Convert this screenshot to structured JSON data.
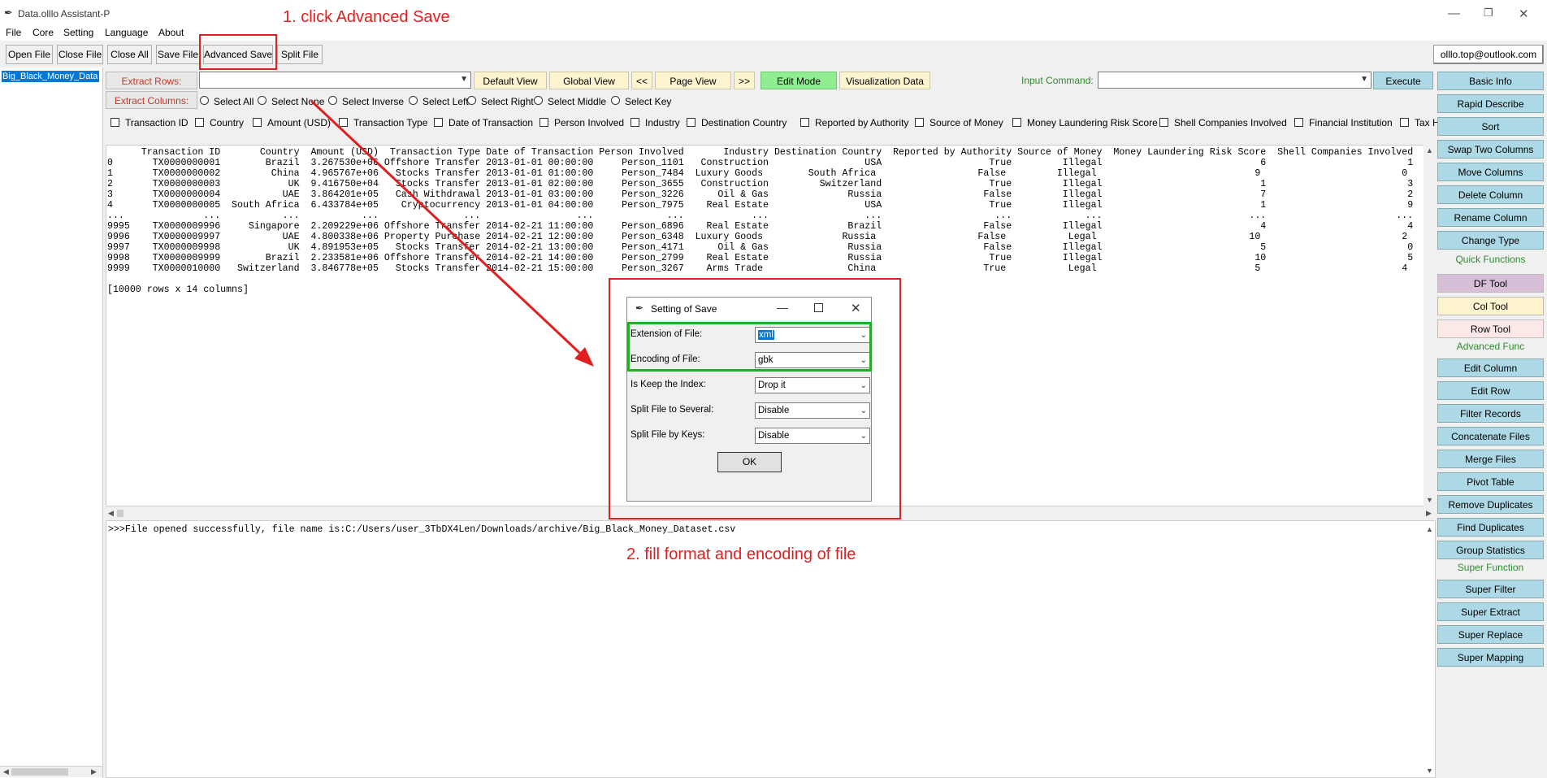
{
  "window": {
    "title": "Data.olllo Assistant-P",
    "controls": {
      "minimize": "—",
      "restore": "❐",
      "close": "✕"
    }
  },
  "menu": [
    "File",
    "Core",
    "Setting",
    "Language",
    "About"
  ],
  "toolbar": {
    "buttons": [
      "Open File",
      "Close File",
      "Close All",
      "Save File",
      "Advanced Save",
      "Split File"
    ],
    "account": "olllo.top@outlook.com"
  },
  "file_list": {
    "selected": "Big_Black_Money_Data"
  },
  "view_bar": {
    "extract_rows": "Extract Rows:",
    "extract_columns": "Extract Columns:",
    "default_view": "Default View",
    "global_view": "Global View",
    "prev": "<<",
    "page_view": "Page View",
    "next": ">>",
    "edit_mode": "Edit Mode",
    "visualization": "Visualization Data",
    "input_command": "Input Command:",
    "execute": "Execute"
  },
  "select_options": [
    "Select All",
    "Select None",
    "Select Inverse",
    "Select Left",
    "Select Right",
    "Select Middle",
    "Select Key"
  ],
  "columns": [
    "Transaction ID",
    "Country",
    "Amount (USD)",
    "Transaction Type",
    "Date of Transaction",
    "Person Involved",
    "Industry",
    "Destination Country",
    "Reported by Authority",
    "Source of Money",
    "Money Laundering Risk Score",
    "Shell Companies Involved",
    "Financial Institution",
    "Tax H"
  ],
  "table_text": [
    "      Transaction ID       Country  Amount (USD)  Transaction Type Date of Transaction Person Involved       Industry Destination Country  Reported by Authority Source of Money  Money Laundering Risk Score  Shell Companies Involved",
    "0       TX0000000001        Brazil  3.267530e+06 Offshore Transfer 2013-01-01 00:00:00     Person_1101   Construction                 USA                   True         Illegal                            6                         1",
    "1       TX0000000002         China  4.965767e+06   Stocks Transfer 2013-01-01 01:00:00     Person_7484  Luxury Goods        South Africa                  False         Illegal                            9                         0",
    "2       TX0000000003            UK  9.416750e+04   Stocks Transfer 2013-01-01 02:00:00     Person_3655   Construction         Switzerland                   True         Illegal                            1                         3",
    "3       TX0000000004           UAE  3.864201e+05   Cash Withdrawal 2013-01-01 03:00:00     Person_3226      Oil & Gas              Russia                  False         Illegal                            7                         2",
    "4       TX0000000005  South Africa  6.433784e+05    Cryptocurrency 2013-01-01 04:00:00     Person_7975    Real Estate                 USA                   True         Illegal                            1                         9",
    "...              ...           ...           ...               ...                 ...             ...            ...                 ...                    ...             ...                          ...                       ...",
    "9995    TX0000009996     Singapore  2.209229e+06 Offshore Transfer 2014-02-21 11:00:00     Person_6896    Real Estate              Brazil                  False         Illegal                            4                         4",
    "9996    TX0000009997           UAE  4.800338e+06 Property Purchase 2014-02-21 12:00:00     Person_6348  Luxury Goods              Russia                  False           Legal                           10                         2",
    "9997    TX0000009998            UK  4.891953e+05   Stocks Transfer 2014-02-21 13:00:00     Person_4171      Oil & Gas              Russia                  False         Illegal                            5                         0",
    "9998    TX0000009999        Brazil  2.233581e+06 Offshore Transfer 2014-02-21 14:00:00     Person_2799    Real Estate              Russia                   True         Illegal                           10                         5",
    "9999    TX0000010000   Switzerland  3.846778e+05   Stocks Transfer 2014-02-21 15:00:00     Person_3267    Arms Trade               China                   True           Legal                            5                         4",
    "",
    "[10000 rows x 14 columns]"
  ],
  "log_text": ">>>File opened successfully, file name is:C:/Users/user_3TbDX4Len/Downloads/archive/Big_Black_Money_Dataset.csv",
  "sidebar": {
    "top": [
      "Basic Info",
      "Rapid Describe",
      "Sort",
      "Swap Two Columns",
      "Move Columns",
      "Delete Column",
      "Rename Column",
      "Change Type"
    ],
    "quick_header": "Quick Functions",
    "quick": [
      "DF Tool",
      "Col Tool",
      "Row Tool"
    ],
    "advanced_header": "Advanced Func",
    "advanced": [
      "Edit Column",
      "Edit Row",
      "Filter Records",
      "Concatenate Files",
      "Merge Files",
      "Pivot Table",
      "Remove Duplicates",
      "Find Duplicates",
      "Group Statistics"
    ],
    "super_header": "Super Function",
    "super": [
      "Super Filter",
      "Super Extract",
      "Super Replace",
      "Super Mapping"
    ]
  },
  "dialog": {
    "title": "Setting of Save",
    "rows": [
      {
        "label": "Extension of File:",
        "value": "xml"
      },
      {
        "label": "Encoding of File:",
        "value": "gbk"
      },
      {
        "label": "Is Keep the Index:",
        "value": "Drop it"
      },
      {
        "label": "Split File to Several:",
        "value": "Disable"
      },
      {
        "label": "Split File by Keys:",
        "value": "Disable"
      }
    ],
    "ok": "OK"
  },
  "annotations": {
    "step1": "1. click Advanced Save",
    "step2": "2. fill format and encoding of file"
  },
  "colors": {
    "annotation_red": "#e02020",
    "highlight_green": "#21b021",
    "side_button": "#add8e6",
    "edit_mode": "#90ee90"
  }
}
